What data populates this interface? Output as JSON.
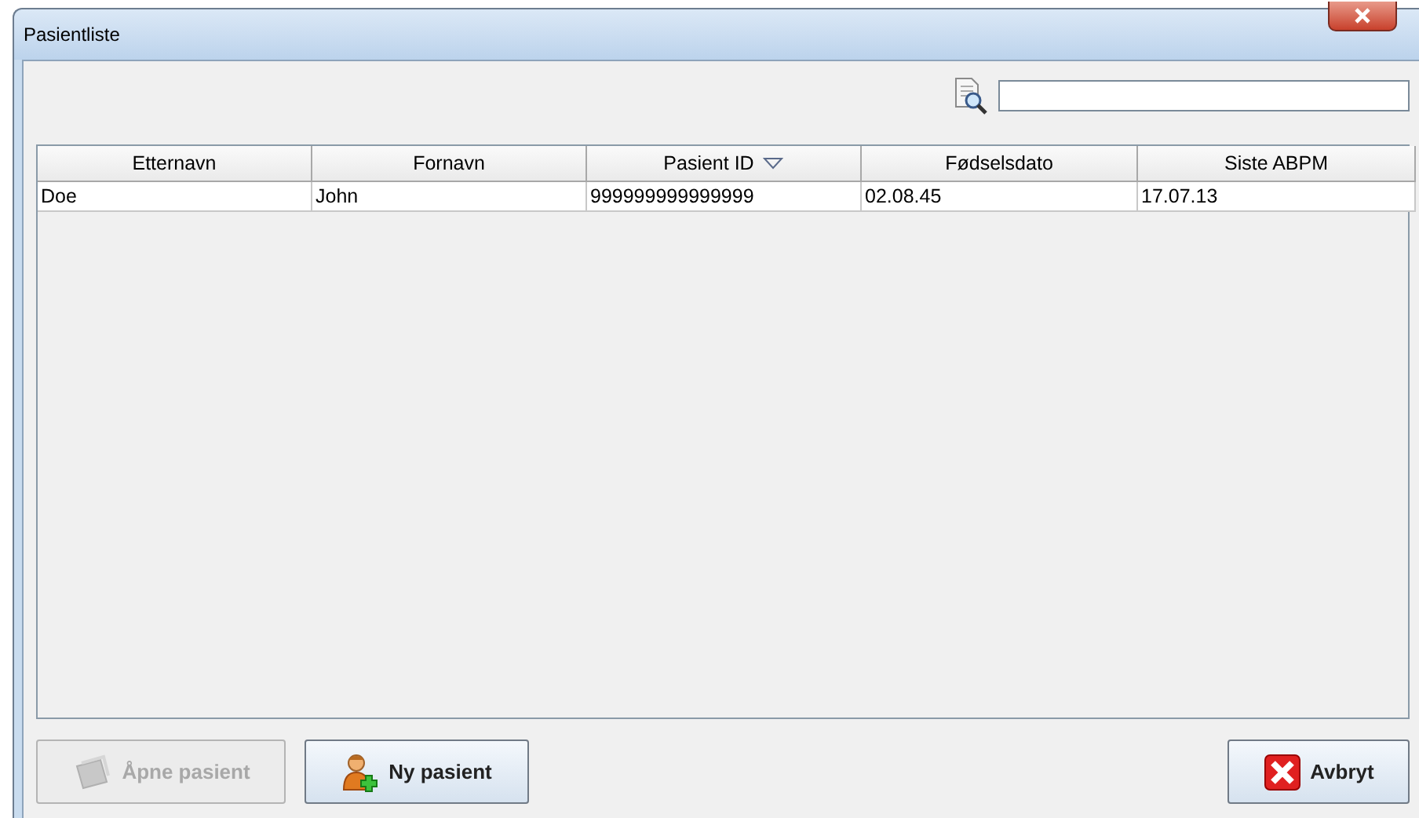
{
  "window": {
    "title": "Pasientliste"
  },
  "table": {
    "columns": [
      {
        "label": "Etternavn",
        "sorted": false
      },
      {
        "label": "Fornavn",
        "sorted": false
      },
      {
        "label": "Pasient ID",
        "sorted": true
      },
      {
        "label": "Fødselsdato",
        "sorted": false
      },
      {
        "label": "Siste ABPM",
        "sorted": false
      }
    ],
    "rows": [
      [
        "Doe",
        "John",
        "999999999999999",
        "02.08.45",
        "17.07.13"
      ]
    ]
  },
  "buttons": [
    {
      "label": "Åpne pasient",
      "kind": "open",
      "disabled": true
    },
    {
      "label": "Ny pasient",
      "kind": "new",
      "disabled": false
    },
    {
      "label": "Avbryt",
      "kind": "cancel",
      "disabled": false
    }
  ]
}
